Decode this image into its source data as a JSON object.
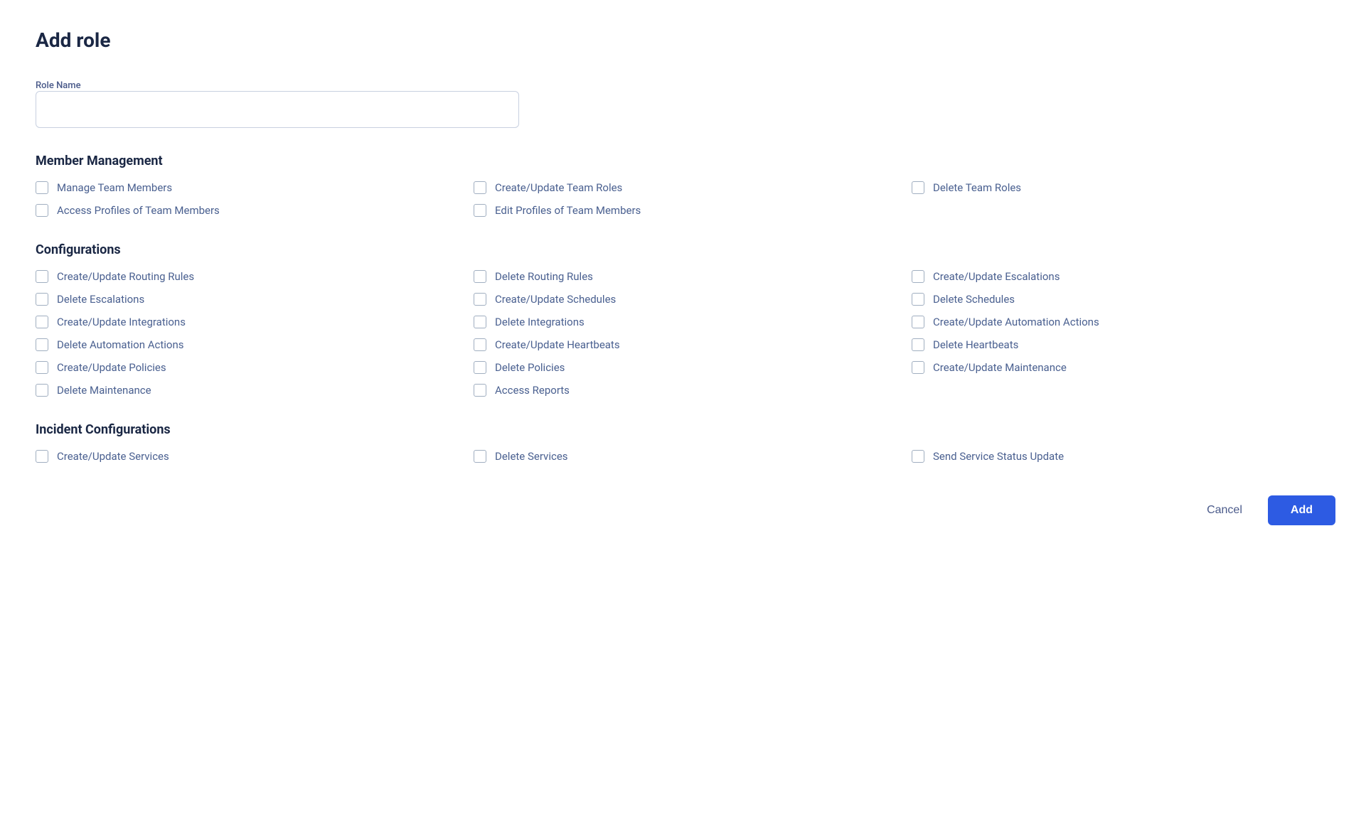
{
  "page": {
    "title": "Add role"
  },
  "form": {
    "role_name_label": "Role Name",
    "role_name_placeholder": ""
  },
  "sections": [
    {
      "id": "member-management",
      "title": "Member Management",
      "permissions": [
        {
          "id": "manage-team-members",
          "label": "Manage Team Members",
          "checked": false
        },
        {
          "id": "create-update-team-roles",
          "label": "Create/Update Team Roles",
          "checked": false
        },
        {
          "id": "delete-team-roles",
          "label": "Delete Team Roles",
          "checked": false
        },
        {
          "id": "access-profiles-team-members",
          "label": "Access Profiles of Team Members",
          "checked": false
        },
        {
          "id": "edit-profiles-team-members",
          "label": "Edit Profiles of Team Members",
          "checked": false
        }
      ]
    },
    {
      "id": "configurations",
      "title": "Configurations",
      "permissions": [
        {
          "id": "create-update-routing-rules",
          "label": "Create/Update Routing Rules",
          "checked": false
        },
        {
          "id": "delete-routing-rules",
          "label": "Delete Routing Rules",
          "checked": false
        },
        {
          "id": "create-update-escalations",
          "label": "Create/Update Escalations",
          "checked": false
        },
        {
          "id": "delete-escalations",
          "label": "Delete Escalations",
          "checked": false
        },
        {
          "id": "create-update-schedules",
          "label": "Create/Update Schedules",
          "checked": false
        },
        {
          "id": "delete-schedules",
          "label": "Delete Schedules",
          "checked": false
        },
        {
          "id": "create-update-integrations",
          "label": "Create/Update Integrations",
          "checked": false
        },
        {
          "id": "delete-integrations",
          "label": "Delete Integrations",
          "checked": false
        },
        {
          "id": "create-update-automation-actions",
          "label": "Create/Update Automation Actions",
          "checked": false
        },
        {
          "id": "delete-automation-actions",
          "label": "Delete Automation Actions",
          "checked": false
        },
        {
          "id": "create-update-heartbeats",
          "label": "Create/Update Heartbeats",
          "checked": false
        },
        {
          "id": "delete-heartbeats",
          "label": "Delete Heartbeats",
          "checked": false
        },
        {
          "id": "create-update-policies",
          "label": "Create/Update Policies",
          "checked": false
        },
        {
          "id": "delete-policies",
          "label": "Delete Policies",
          "checked": false
        },
        {
          "id": "create-update-maintenance",
          "label": "Create/Update Maintenance",
          "checked": false
        },
        {
          "id": "delete-maintenance",
          "label": "Delete Maintenance",
          "checked": false
        },
        {
          "id": "access-reports",
          "label": "Access Reports",
          "checked": false
        }
      ]
    },
    {
      "id": "incident-configurations",
      "title": "Incident Configurations",
      "permissions": [
        {
          "id": "create-update-services",
          "label": "Create/Update Services",
          "checked": false
        },
        {
          "id": "delete-services",
          "label": "Delete Services",
          "checked": false
        },
        {
          "id": "send-service-status-update",
          "label": "Send Service Status Update",
          "checked": false
        }
      ]
    }
  ],
  "actions": {
    "cancel_label": "Cancel",
    "add_label": "Add"
  }
}
